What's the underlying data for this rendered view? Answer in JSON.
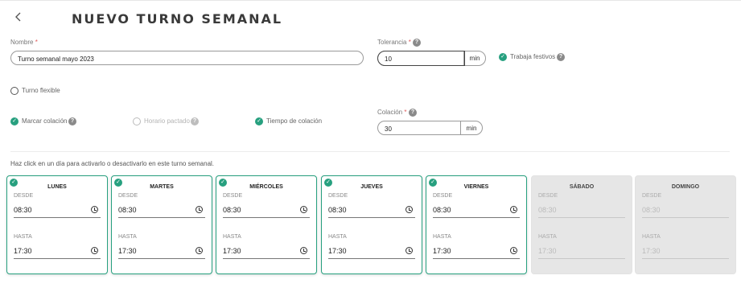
{
  "header": {
    "title": "NUEVO TURNO SEMANAL",
    "back_icon": "chevron-left-icon"
  },
  "form": {
    "nombre": {
      "label": "Nombre",
      "required_mark": "*",
      "value": "Turno semanal mayo 2023"
    },
    "tolerancia": {
      "label": "Tolerancia",
      "required_mark": "*",
      "help": "?",
      "value": "10",
      "unit": "min"
    },
    "trabaja_festivos": {
      "label": "Trabaja festivos",
      "checked": true,
      "help": "?"
    },
    "turno_flexible": {
      "label": "Turno flexible",
      "checked": false
    },
    "marcar_colacion": {
      "label": "Marcar colación",
      "checked": true,
      "help": "?"
    },
    "horario_pactado": {
      "label": "Horario pactado",
      "checked": false,
      "disabled": true,
      "help": "?"
    },
    "tiempo_colacion": {
      "label": "Tiempo de colación",
      "checked": true
    },
    "colacion": {
      "label": "Colación",
      "required_mark": "*",
      "help": "?",
      "value": "30",
      "unit": "min"
    }
  },
  "days_hint": "Haz click en un día para activarlo o desactivarlo en este turno semanal.",
  "days": [
    {
      "name": "LUNES",
      "active": true,
      "desde_label": "DESDE",
      "desde": "08:30",
      "hasta_label": "HASTA",
      "hasta": "17:30"
    },
    {
      "name": "MARTES",
      "active": true,
      "desde_label": "DESDE",
      "desde": "08:30",
      "hasta_label": "HASTA",
      "hasta": "17:30"
    },
    {
      "name": "MIÉRCOLES",
      "active": true,
      "desde_label": "DESDE",
      "desde": "08:30",
      "hasta_label": "HASTA",
      "hasta": "17:30"
    },
    {
      "name": "JUEVES",
      "active": true,
      "desde_label": "DESDE",
      "desde": "08:30",
      "hasta_label": "HASTA",
      "hasta": "17:30"
    },
    {
      "name": "VIERNES",
      "active": true,
      "desde_label": "DESDE",
      "desde": "08:30",
      "hasta_label": "HASTA",
      "hasta": "17:30"
    },
    {
      "name": "SÁBADO",
      "active": false,
      "desde_label": "DESDE",
      "desde": "08:30",
      "hasta_label": "HASTA",
      "hasta": "17:30"
    },
    {
      "name": "DOMINGO",
      "active": false,
      "desde_label": "DESDE",
      "desde": "08:30",
      "hasta_label": "HASTA",
      "hasta": "17:30"
    }
  ],
  "colors": {
    "accent": "#27a07f",
    "inactive_bg": "#e6e6e6"
  }
}
